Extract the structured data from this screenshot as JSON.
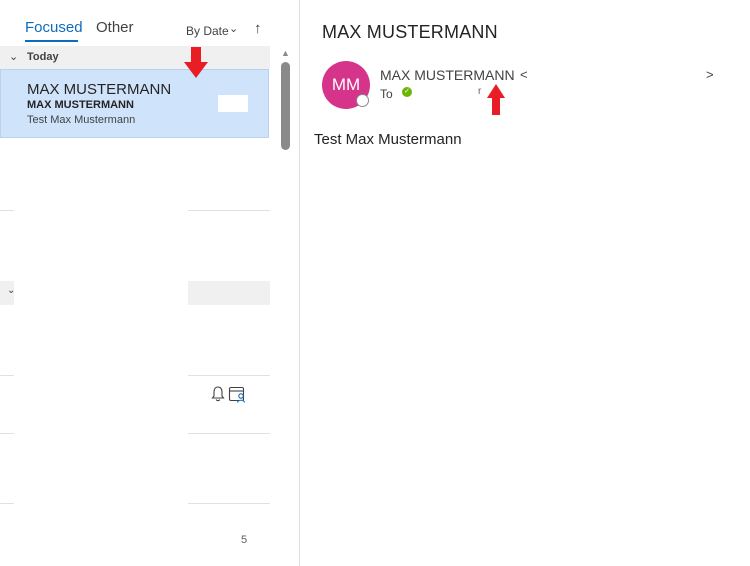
{
  "list": {
    "tabs": [
      {
        "label": "Focused",
        "active": true
      },
      {
        "label": "Other",
        "active": false
      }
    ],
    "sort": {
      "label": "By Date",
      "direction_icon": "arrow-up-icon"
    },
    "groups": [
      {
        "label": "Today"
      }
    ],
    "selected_message": {
      "sender": "MAX MUSTERMANN",
      "subject": "MAX MUSTERMANN",
      "preview": "Test Max Mustermann"
    },
    "row_icons": [
      "bell-icon",
      "calendar-person-icon"
    ],
    "fragment_text": "5"
  },
  "reading_pane": {
    "title": "MAX MUSTERMANN",
    "avatar_initials": "MM",
    "avatar_color": "#d6338a",
    "from_name": "MAX MUSTERMANN",
    "from_open_bracket": "<",
    "from_close_bracket": ">",
    "to_label": "To",
    "to_fragment": "r",
    "body": "Test Max Mustermann"
  },
  "colors": {
    "accent": "#0f6cbd",
    "selected_row": "#cfe4fa",
    "annotation_arrow": "#e81e24",
    "presence_available": "#6bb700"
  }
}
